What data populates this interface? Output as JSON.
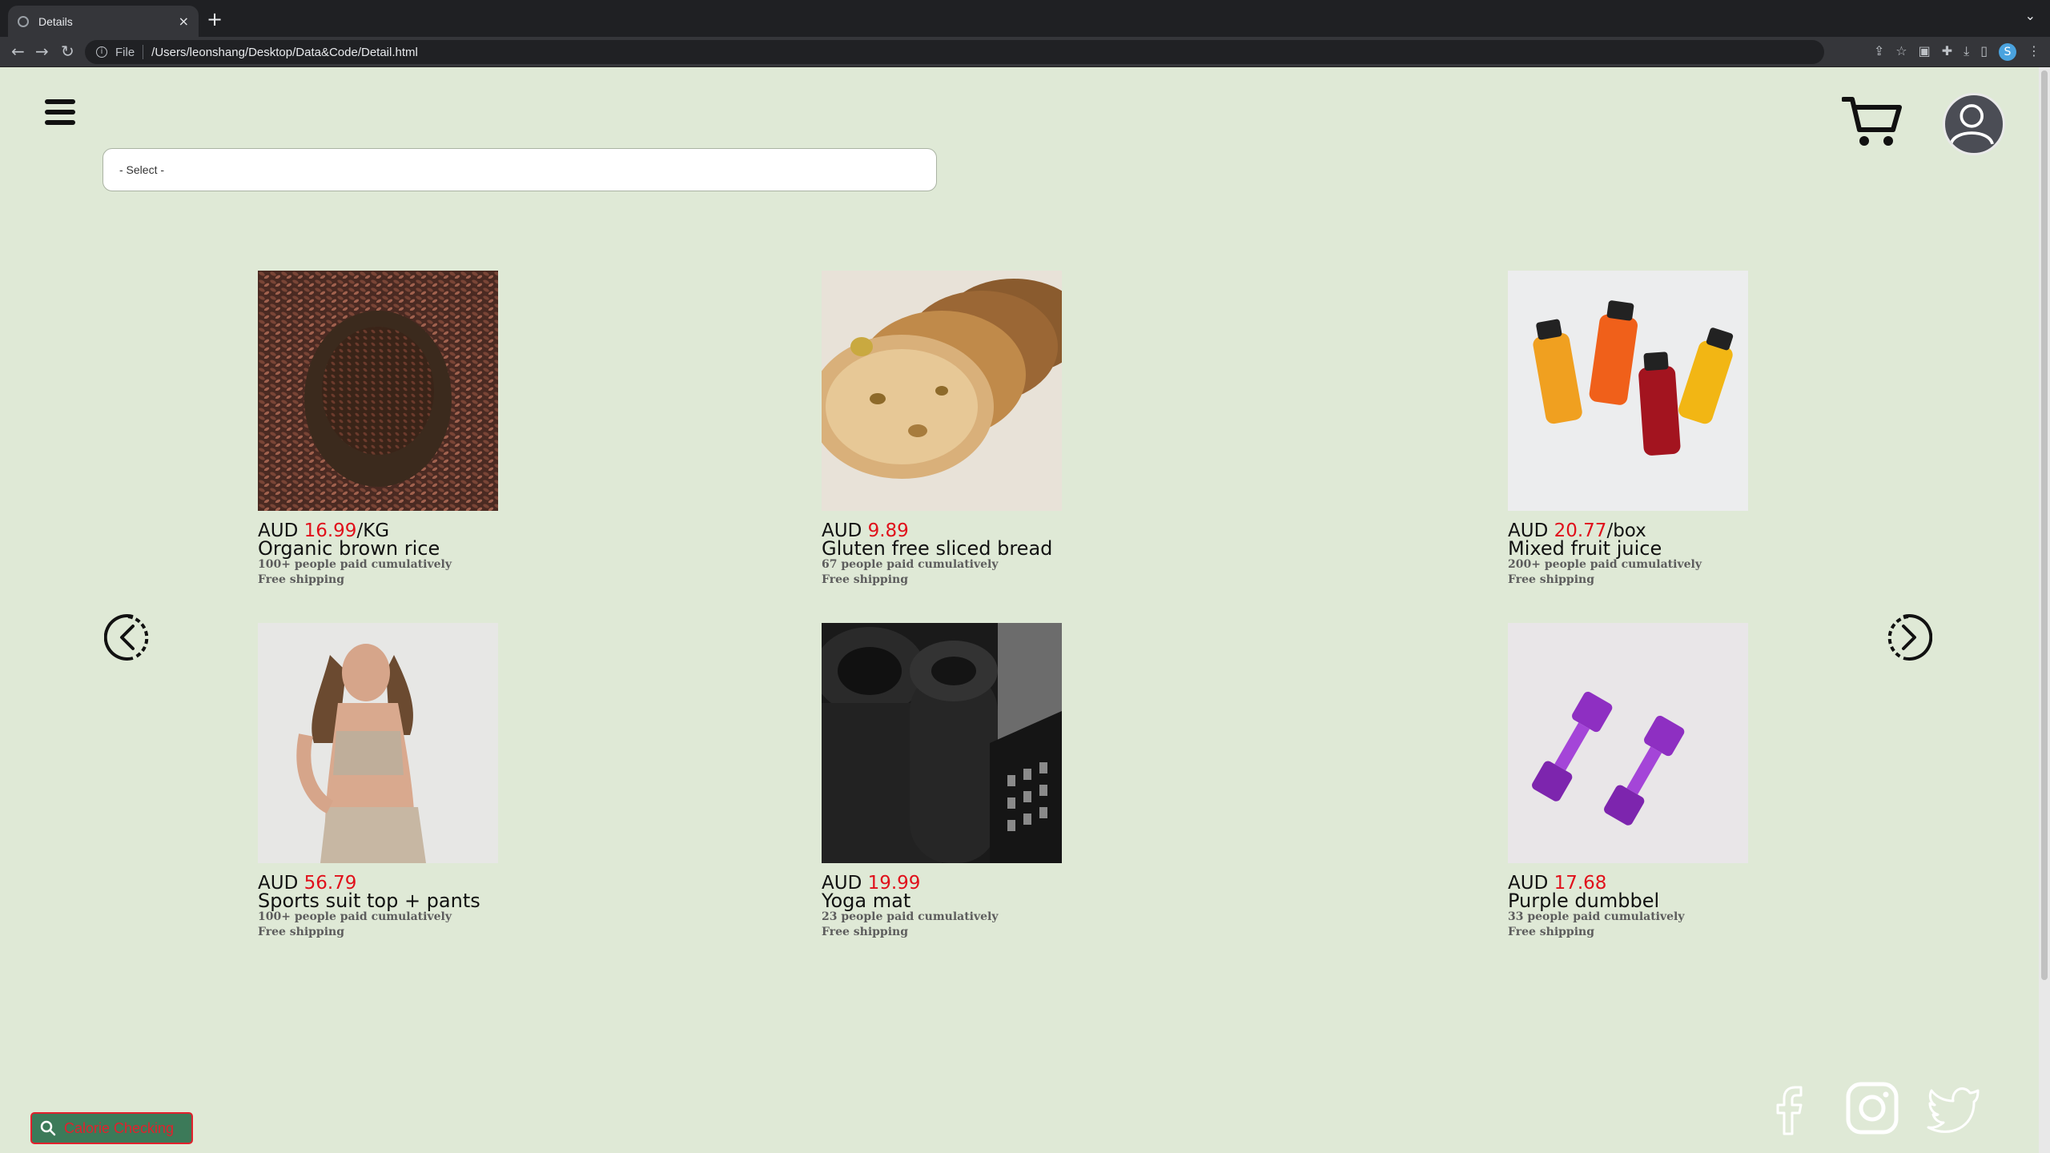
{
  "browser": {
    "tab_title": "Details",
    "tab_close": "×",
    "new_tab": "+",
    "tab_menu": "⌄",
    "scheme_label": "File",
    "url": "/Users/leonshang/Desktop/Data&Code/Detail.html",
    "profile_letter": "S"
  },
  "select": {
    "placeholder": "- Select -"
  },
  "products": [
    {
      "currency": "AUD",
      "price": "16.99",
      "unit": "/KG",
      "name": "Organic brown rice",
      "sold": "100+ people paid cumulatively",
      "shipping": "Free shipping"
    },
    {
      "currency": "AUD",
      "price": "9.89",
      "unit": "",
      "name": "Gluten free sliced bread",
      "sold": "67 people paid cumulatively",
      "shipping": "Free shipping"
    },
    {
      "currency": "AUD",
      "price": "20.77",
      "unit": "/box",
      "name": "Mixed fruit juice",
      "sold": "200+ people paid cumulatively",
      "shipping": "Free shipping"
    },
    {
      "currency": "AUD",
      "price": "56.79",
      "unit": "",
      "name": "Sports suit top + pants",
      "sold": "100+ people paid cumulatively",
      "shipping": "Free shipping"
    },
    {
      "currency": "AUD",
      "price": "19.99",
      "unit": "",
      "name": "Yoga mat",
      "sold": "23 people paid cumulatively",
      "shipping": "Free shipping"
    },
    {
      "currency": "AUD",
      "price": "17.68",
      "unit": "",
      "name": "Purple dumbbel",
      "sold": "33 people paid cumulatively",
      "shipping": "Free shipping"
    }
  ],
  "calorie_button": {
    "label": "Calorie Checking"
  },
  "colors": {
    "background": "#dfe9d6",
    "price_red": "#e0101b",
    "calorie_green": "#3c7a59"
  }
}
